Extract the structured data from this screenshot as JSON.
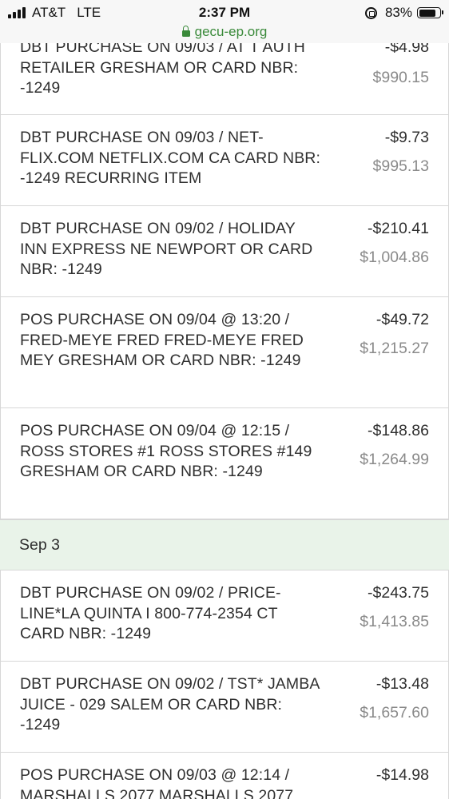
{
  "status_bar": {
    "carrier": "AT&T",
    "network": "LTE",
    "time": "2:37 PM",
    "battery_percent": "83%",
    "battery_level": 0.83
  },
  "url_bar": {
    "url": "gecu-ep.org"
  },
  "transactions_top": [
    {
      "description": "DBT PURCHASE ON 09/03 / AT T AUTH RETAILER GRESHAM OR CARD NBR: -1249",
      "amount": "-$4.98",
      "balance": "$990.15"
    },
    {
      "description": "DBT PURCHASE ON 09/03 / NET-FLIX.COM NETFLIX.COM CA CARD NBR: -1249 RECURRING ITEM",
      "amount": "-$9.73",
      "balance": "$995.13"
    },
    {
      "description": "DBT PURCHASE ON 09/02 / HOLIDAY INN EXPRESS NE NEWPORT OR CARD NBR: -1249",
      "amount": "-$210.41",
      "balance": "$1,004.86"
    },
    {
      "description": "POS PURCHASE ON 09/04 @ 13:20 / FRED-MEYE FRED FRED-MEYE FRED MEY GRESHAM OR CARD NBR: -1249",
      "amount": "-$49.72",
      "balance": "$1,215.27"
    },
    {
      "description": "POS PURCHASE ON 09/04 @ 12:15 / ROSS STORES #1 ROSS STORES #149 GRESHAM OR CARD NBR: -1249",
      "amount": "-$148.86",
      "balance": "$1,264.99"
    }
  ],
  "date_group": {
    "label": "Sep 3"
  },
  "transactions_bottom": [
    {
      "description": "DBT PURCHASE ON 09/02 / PRICE-LINE*LA QUINTA I 800-774-2354 CT CARD NBR: -1249",
      "amount": "-$243.75",
      "balance": "$1,413.85"
    },
    {
      "description": "DBT PURCHASE ON 09/02 / TST* JAMBA JUICE - 029 SALEM OR CARD NBR: -1249",
      "amount": "-$13.48",
      "balance": "$1,657.60"
    },
    {
      "description": "POS PURCHASE ON 09/03 @ 12:14 / MARSHALLS 2077 MARSHALLS 2077",
      "amount": "-$14.98",
      "balance": ""
    }
  ]
}
